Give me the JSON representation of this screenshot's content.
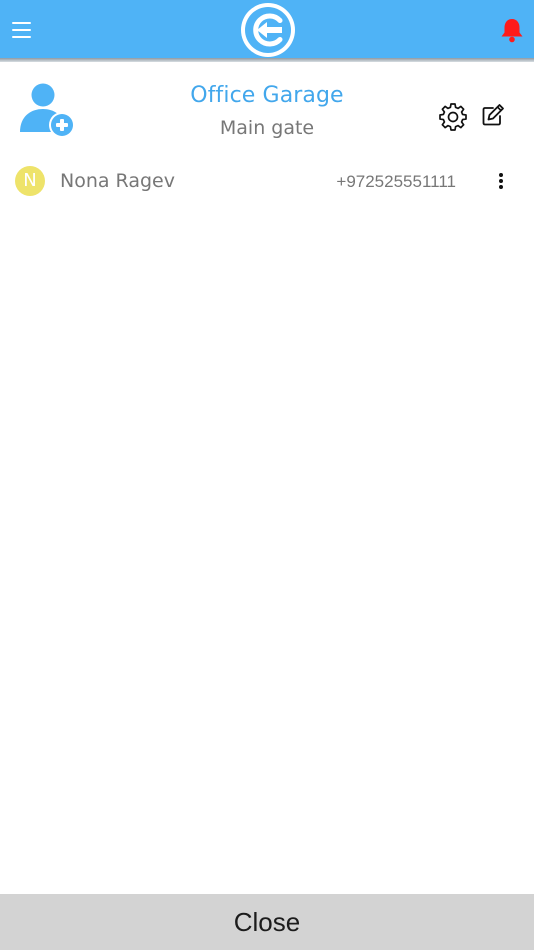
{
  "header": {
    "logo_name": "app-logo",
    "menu_icon": "hamburger-menu-icon",
    "notification_icon": "bell-icon",
    "bell_color": "#ff1a1a",
    "bar_color": "#4fb3f6"
  },
  "gate": {
    "title": "Office Garage",
    "subtitle": "Main gate",
    "add_user_icon": "add-user-icon",
    "settings_icon": "gear-icon",
    "edit_icon": "edit-icon"
  },
  "users": [
    {
      "initial": "N",
      "name": "Nona Ragev",
      "phone": "+972525551111",
      "avatar_color": "#eee36a"
    }
  ],
  "footer": {
    "close_label": "Close"
  }
}
